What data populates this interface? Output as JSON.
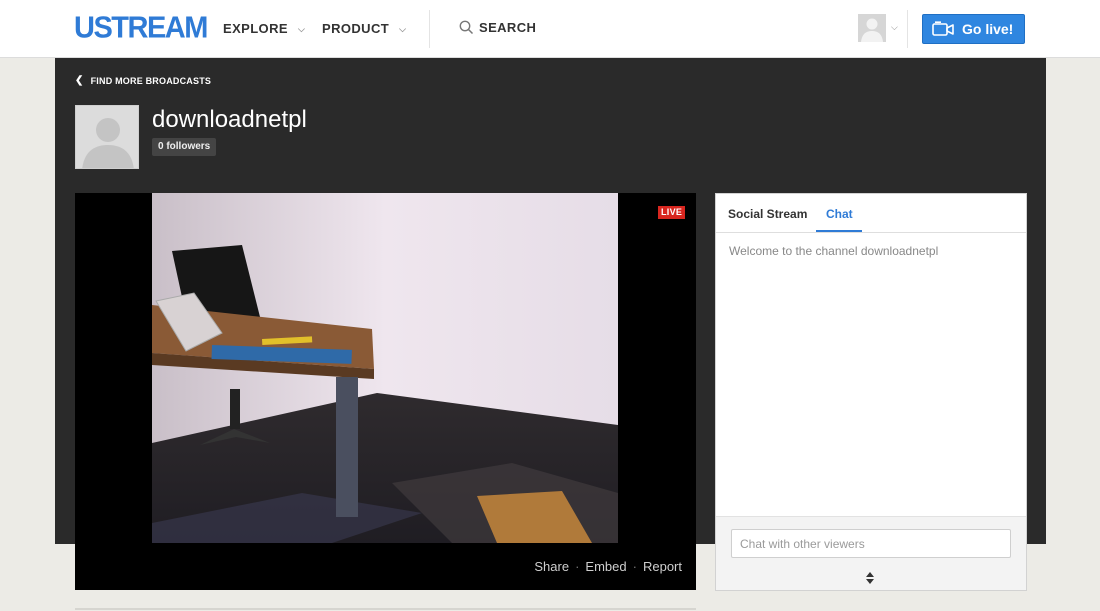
{
  "header": {
    "logo": "USTREAM",
    "nav": [
      {
        "label": "EXPLORE"
      },
      {
        "label": "PRODUCT"
      }
    ],
    "search_label": "SEARCH",
    "go_live_label": "Go live!"
  },
  "channel": {
    "back_link": "FIND MORE BROADCASTS",
    "name": "downloadnetpl",
    "followers": "0 followers"
  },
  "player": {
    "live_badge": "LIVE",
    "links": {
      "share": "Share",
      "embed": "Embed",
      "report": "Report"
    }
  },
  "chat": {
    "tabs": [
      {
        "label": "Social Stream",
        "active": false
      },
      {
        "label": "Chat",
        "active": true
      }
    ],
    "welcome": "Welcome to the channel downloadnetpl",
    "input_placeholder": "Chat with other viewers"
  },
  "colors": {
    "brand": "#2f7bd6",
    "live": "#d8261f",
    "dark_panel": "#2a2a2a"
  }
}
